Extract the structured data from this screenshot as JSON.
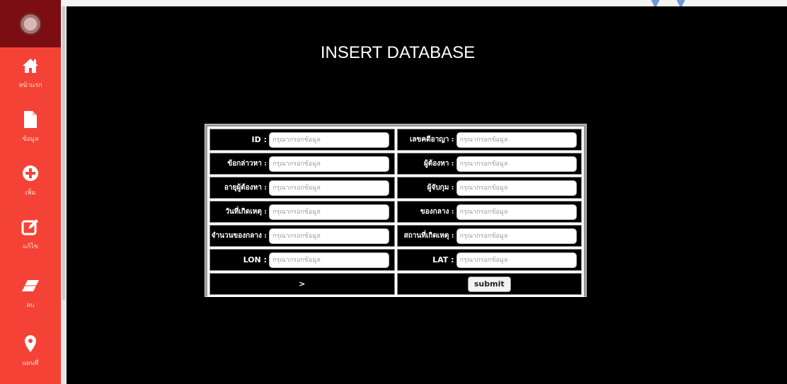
{
  "page": {
    "title": "INSERT DATABASE"
  },
  "sidebar": {
    "logo": "round-emblem-icon",
    "items": [
      {
        "icon": "home-icon",
        "label": "หน้าแรก"
      },
      {
        "icon": "file-icon",
        "label": "ข้อมูล"
      },
      {
        "icon": "plus-circle-icon",
        "label": "เพิ่ม"
      },
      {
        "icon": "edit-icon",
        "label": "แก้ไข"
      },
      {
        "icon": "eraser-icon",
        "label": "ลบ"
      },
      {
        "icon": "map-marker-icon",
        "label": "แผนที่"
      }
    ]
  },
  "form": {
    "placeholder": "กรุณากรอกข้อมูล",
    "rows": [
      {
        "left_label": "ID :",
        "right_label": "เลขคดีอาญา :"
      },
      {
        "left_label": "ข้อกล่าวหา :",
        "right_label": "ผู้ต้องหา :"
      },
      {
        "left_label": "อายุผู้ต้องหา :",
        "right_label": "ผู้จับกุม :"
      },
      {
        "left_label": "วันที่เกิดเหตุ :",
        "right_label": "ของกลาง :"
      },
      {
        "left_label": "จำนวนของกลาง :",
        "right_label": "สถานที่เกิดเหตุ :"
      },
      {
        "left_label": "LON :",
        "right_label": "LAT :"
      }
    ],
    "bottom_left_text": ">",
    "submit_label": "submit"
  }
}
